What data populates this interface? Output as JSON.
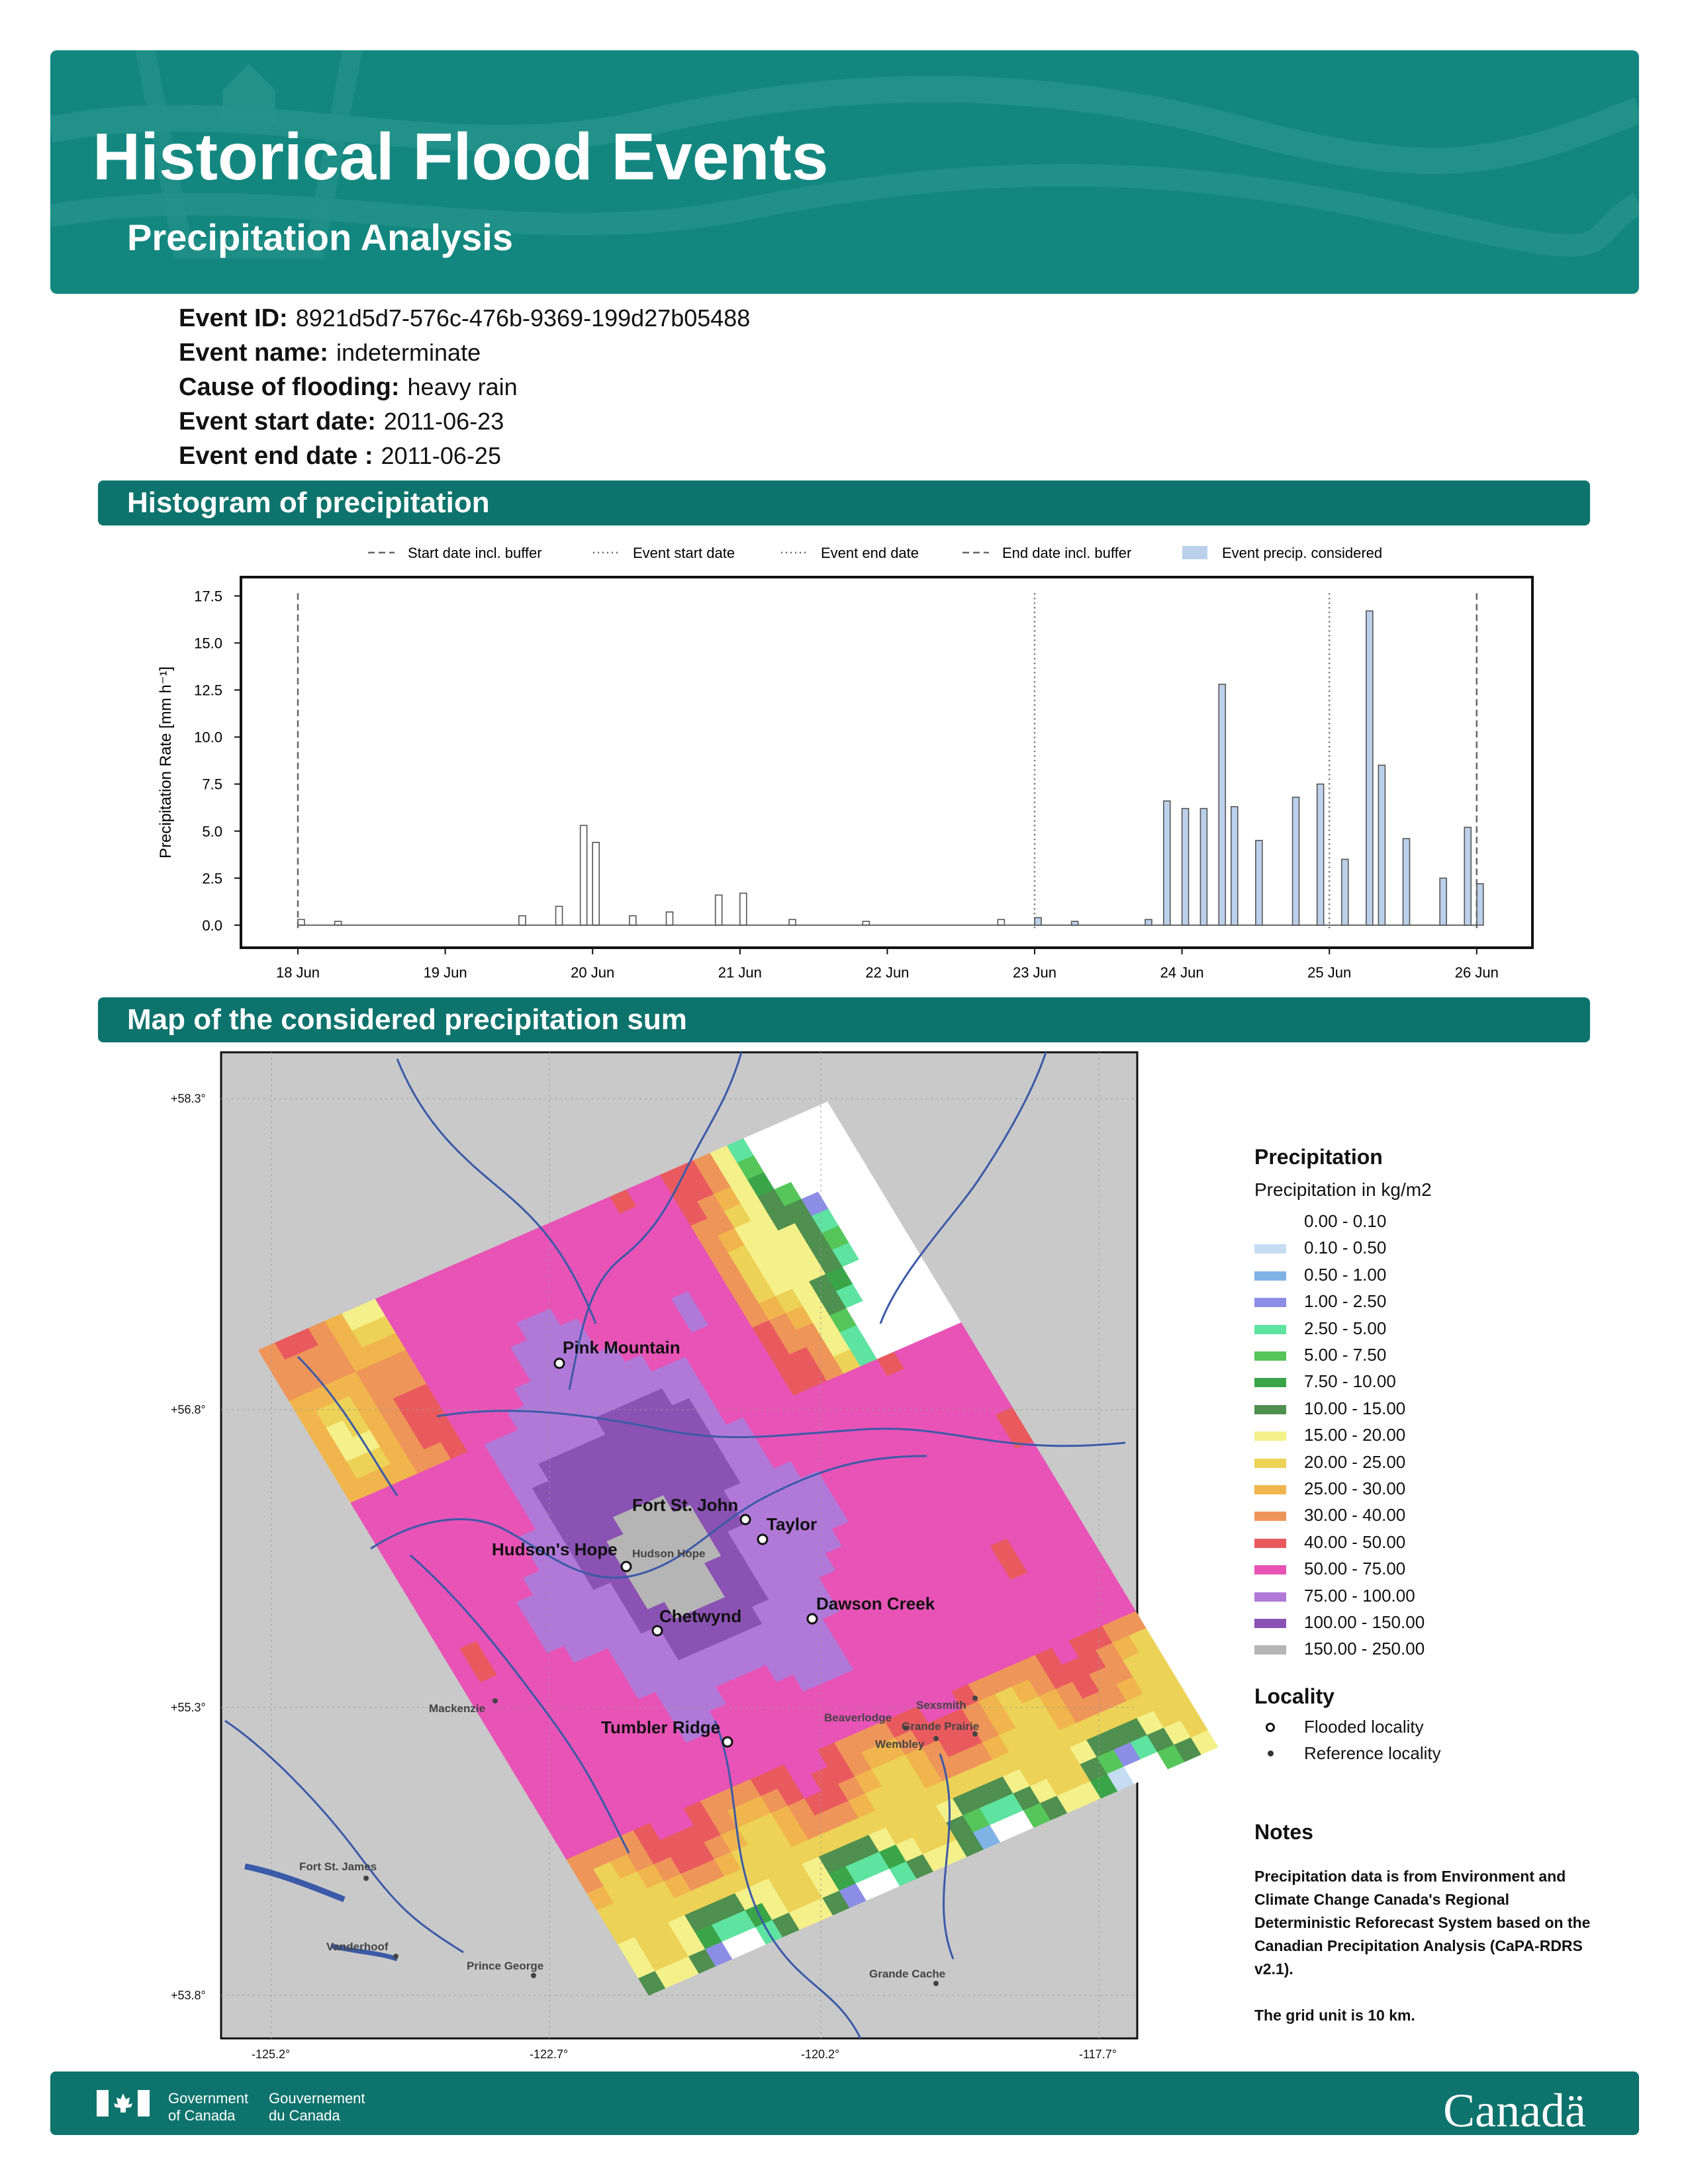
{
  "header": {
    "title": "Historical Flood Events",
    "subtitle": "Precipitation Analysis"
  },
  "event": {
    "id_label": "Event ID:",
    "id_value": "8921d5d7-576c-476b-9369-199d27b05488",
    "name_label": "Event name:",
    "name_value": "indeterminate",
    "cause_label": "Cause of flooding:",
    "cause_value": "heavy rain",
    "start_label": "Event start date:",
    "start_value": "2011-06-23",
    "end_label": "Event end date :",
    "end_value": "2011-06-25"
  },
  "sections": {
    "histogram": "Histogram of precipitation",
    "map": "Map of the considered precipitation sum"
  },
  "chart_data": {
    "type": "bar",
    "title": "",
    "xlabel": "",
    "ylabel": "Precipitation Rate [mm h⁻¹]",
    "ylim": [
      -1.2,
      18.5
    ],
    "yticks": [
      "0.0",
      "2.5",
      "5.0",
      "7.5",
      "10.0",
      "12.5",
      "15.0",
      "17.5"
    ],
    "xticks": [
      "18 Jun",
      "19 Jun",
      "20 Jun",
      "21 Jun",
      "22 Jun",
      "23 Jun",
      "24 Jun",
      "25 Jun",
      "26 Jun"
    ],
    "legend": {
      "placement": "top",
      "entries": [
        "Start date incl. buffer",
        "Event start date",
        "Event end date",
        "End date incl. buffer",
        "Event precip. considered"
      ]
    },
    "reference_lines": [
      {
        "name": "Start date incl. buffer",
        "x": "2011-06-18 00:00",
        "style": "dashed"
      },
      {
        "name": "Event start date",
        "x": "2011-06-23 00:00",
        "style": "dotted"
      },
      {
        "name": "Event end date",
        "x": "2011-06-25 00:00",
        "style": "dotted"
      },
      {
        "name": "End date incl. buffer",
        "x": "2011-06-26 00:00",
        "style": "dashed"
      }
    ],
    "series": [
      {
        "values": [
          [
            "2011-06-18 00:00",
            0.3
          ],
          [
            "2011-06-18 06:00",
            0.2
          ],
          [
            "2011-06-19 12:00",
            0.5
          ],
          [
            "2011-06-19 18:00",
            1.0
          ],
          [
            "2011-06-19 22:00",
            5.3
          ],
          [
            "2011-06-20 00:00",
            4.4
          ],
          [
            "2011-06-20 06:00",
            0.5
          ],
          [
            "2011-06-20 12:00",
            0.7
          ],
          [
            "2011-06-20 20:00",
            1.6
          ],
          [
            "2011-06-21 00:00",
            1.7
          ],
          [
            "2011-06-21 08:00",
            0.3
          ],
          [
            "2011-06-21 20:00",
            0.2
          ],
          [
            "2011-06-22 18:00",
            0.3
          ],
          [
            "2011-06-23 00:00",
            0.4
          ],
          [
            "2011-06-23 06:00",
            0.2
          ],
          [
            "2011-06-23 18:00",
            0.3
          ],
          [
            "2011-06-23 21:00",
            6.6
          ],
          [
            "2011-06-24 00:00",
            6.2
          ],
          [
            "2011-06-24 03:00",
            6.2
          ],
          [
            "2011-06-24 06:00",
            12.8
          ],
          [
            "2011-06-24 08:00",
            6.3
          ],
          [
            "2011-06-24 12:00",
            4.5
          ],
          [
            "2011-06-24 18:00",
            6.8
          ],
          [
            "2011-06-24 22:00",
            7.5
          ],
          [
            "2011-06-25 02:00",
            3.5
          ],
          [
            "2011-06-25 06:00",
            16.7
          ],
          [
            "2011-06-25 08:00",
            8.5
          ],
          [
            "2011-06-25 12:00",
            4.6
          ],
          [
            "2011-06-25 18:00",
            2.5
          ],
          [
            "2011-06-25 22:00",
            5.2
          ],
          [
            "2011-06-26 00:00",
            2.2
          ]
        ]
      }
    ]
  },
  "map": {
    "lat_labels": [
      "+58.3°",
      "+56.8°",
      "+55.3°",
      "+53.8°"
    ],
    "lon_labels": [
      "-125.2°",
      "-122.7°",
      "-120.2°",
      "-117.7°"
    ],
    "flooded_localities": [
      "Pink Mountain",
      "Fort St. John",
      "Taylor",
      "Hudson's Hope",
      "Chetwynd",
      "Dawson Creek",
      "Tumbler Ridge"
    ],
    "reference_localities": [
      "Hudson Hope",
      "Mackenzie",
      "Sexsmith",
      "Beaverlodge",
      "Grande Prairie",
      "Wembley",
      "Fort St. James",
      "Vanderhoof",
      "Prince George",
      "Grande Cache"
    ]
  },
  "legend": {
    "title": "Precipitation",
    "subtitle": "Precipitation in kg/m2",
    "classes": [
      {
        "label": "0.00 - 0.10",
        "color": "#ffffff"
      },
      {
        "label": "0.10 - 0.50",
        "color": "#c6dcf2"
      },
      {
        "label": "0.50 - 1.00",
        "color": "#7fb3e6"
      },
      {
        "label": "1.00 - 2.50",
        "color": "#8c8ee6"
      },
      {
        "label": "2.50 - 5.00",
        "color": "#5fe3a0"
      },
      {
        "label": "5.00 - 7.50",
        "color": "#56c65a"
      },
      {
        "label": "7.50 - 10.00",
        "color": "#3aa548"
      },
      {
        "label": "10.00 - 15.00",
        "color": "#4f8f4f"
      },
      {
        "label": "15.00 - 20.00",
        "color": "#f4f08a"
      },
      {
        "label": "20.00 - 25.00",
        "color": "#ecd257"
      },
      {
        "label": "25.00 - 30.00",
        "color": "#f0b64d"
      },
      {
        "label": "30.00 - 40.00",
        "color": "#ee955a"
      },
      {
        "label": "40.00 - 50.00",
        "color": "#e95a5e"
      },
      {
        "label": "50.00 - 75.00",
        "color": "#e853b6"
      },
      {
        "label": "75.00 - 100.00",
        "color": "#b079d8"
      },
      {
        "label": "100.00 - 150.00",
        "color": "#8a52b2"
      },
      {
        "label": "150.00 - 250.00",
        "color": "#b5b5b5"
      }
    ],
    "locality_title": "Locality",
    "flooded_label": "Flooded locality",
    "reference_label": "Reference locality"
  },
  "notes": {
    "title": "Notes",
    "text1": "Precipitation data is from Environment and Climate Change Canada's Regional Deterministic Reforecast System based on the Canadian Precipitation Analysis (CaPA-RDRS v2.1).",
    "text2": "The grid unit is 10 km."
  },
  "footer": {
    "gov_en_1": "Government",
    "gov_en_2": "of Canada",
    "gov_fr_1": "Gouvernement",
    "gov_fr_2": "du Canada",
    "wordmark": "Canadä"
  }
}
